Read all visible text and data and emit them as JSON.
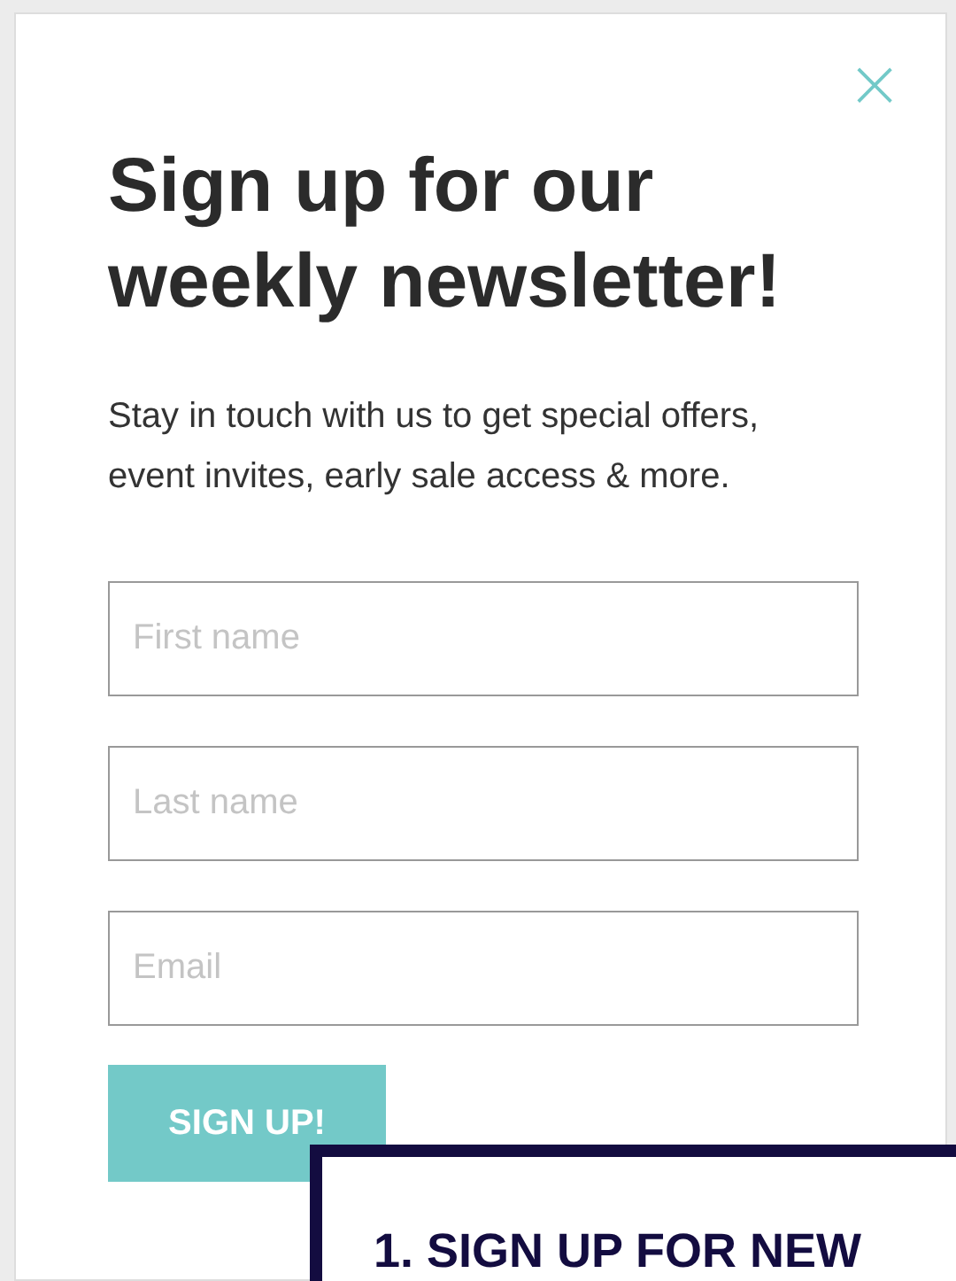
{
  "dialog": {
    "close": "×",
    "title": "Sign up for our weekly newsletter!",
    "description": "Stay in touch with us to get special offers, event invites, early sale access & more.",
    "fields": [
      {
        "placeholder": "First name"
      },
      {
        "placeholder": "Last name"
      },
      {
        "placeholder": "Email"
      }
    ],
    "button": "SIGN UP!"
  },
  "overlay_card": {
    "heading": "1. SIGN UP FOR NEW"
  }
}
